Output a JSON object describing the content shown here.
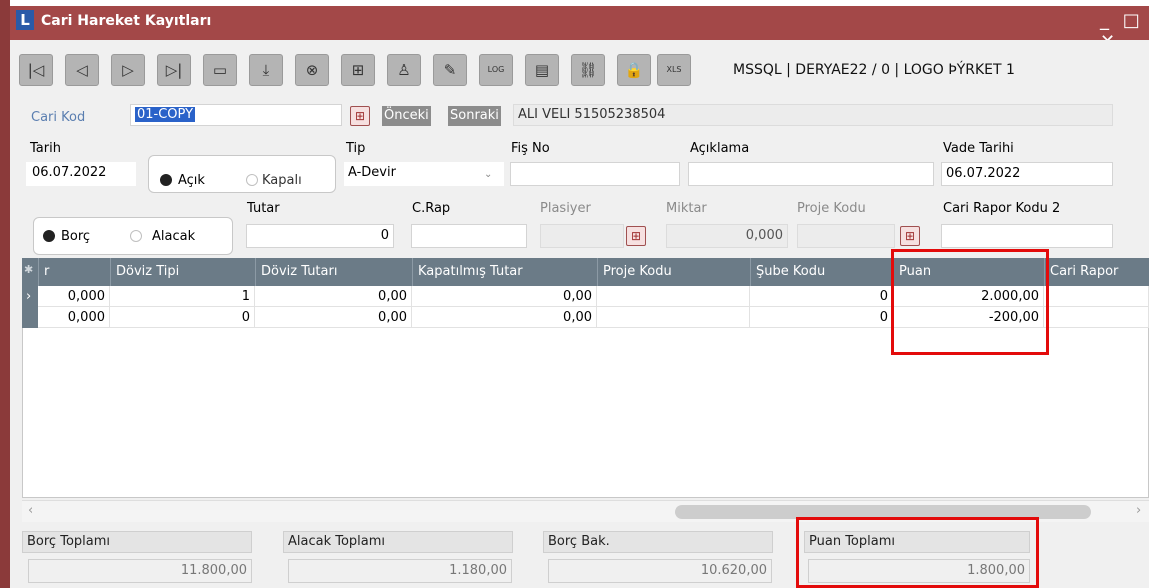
{
  "window": {
    "title": "Cari Hareket Kayıtları",
    "logo_letter": "L",
    "controls": "_ □ ✕"
  },
  "toolbar": {
    "db_info": "MSSQL | DERYAE22 / 0 | LOGO ÞÝRKET 1",
    "buttons": [
      {
        "name": "first-record",
        "glyph": "|◁"
      },
      {
        "name": "prev-record",
        "glyph": "◁"
      },
      {
        "name": "next-record",
        "glyph": "▷"
      },
      {
        "name": "last-record",
        "glyph": "▷|"
      },
      {
        "name": "browse",
        "glyph": "▭"
      },
      {
        "name": "download",
        "glyph": "⤓"
      },
      {
        "name": "cancel",
        "glyph": "⊗"
      },
      {
        "name": "new",
        "glyph": "⊞"
      },
      {
        "name": "user",
        "glyph": "♙"
      },
      {
        "name": "edit",
        "glyph": "✎"
      },
      {
        "name": "log",
        "glyph": "LOG"
      },
      {
        "name": "document",
        "glyph": "▤"
      },
      {
        "name": "link",
        "glyph": "⛓"
      },
      {
        "name": "lock",
        "glyph": "🔒"
      },
      {
        "name": "xls",
        "glyph": "XLS"
      }
    ]
  },
  "form": {
    "cari_kod_label": "Cari Kod",
    "cari_kod_value": "01-COPY",
    "onceki_label": "Önceki",
    "sonraki_label": "Sonraki",
    "cari_name": "ALI VELI 51505238504",
    "tarih_label": "Tarih",
    "tarih_value": "06.07.2022",
    "acik_label": "Açık",
    "kapali_label": "Kapalı",
    "tip_label": "Tip",
    "tip_value": "A-Devir",
    "fis_no_label": "Fiş No",
    "fis_no_value": "",
    "aciklama_label": "Açıklama",
    "aciklama_value": "",
    "vade_tarihi_label": "Vade Tarihi",
    "vade_tarihi_value": "06.07.2022",
    "tutar_label": "Tutar",
    "tutar_value": "0",
    "borc_label": "Borç",
    "alacak_label": "Alacak",
    "crap_label": "C.Rap",
    "plasiyer_label": "Plasiyer",
    "miktar_label": "Miktar",
    "miktar_value": "0,000",
    "proje_kodu_label": "Proje Kodu",
    "cari_rapor_kodu2_label": "Cari Rapor Kodu 2"
  },
  "grid": {
    "columns": [
      "r",
      "Döviz Tipi",
      "Döviz Tutarı",
      "Kapatılmış Tutar",
      "Proje Kodu",
      "Şube Kodu",
      "Puan",
      "Cari Rapor"
    ],
    "rows": [
      [
        "0,000",
        "1",
        "0,00",
        "0,00",
        "",
        "0",
        "2.000,00",
        ""
      ],
      [
        "0,000",
        "0",
        "0,00",
        "0,00",
        "",
        "0",
        "-200,00",
        ""
      ]
    ]
  },
  "footer": {
    "borc_toplami_label": "Borç Toplamı",
    "borc_toplami_value": "11.800,00",
    "alacak_toplami_label": "Alacak Toplamı",
    "alacak_toplami_value": "1.180,00",
    "borc_bak_label": "Borç Bak.",
    "borc_bak_value": "10.620,00",
    "puan_toplami_label": "Puan Toplamı",
    "puan_toplami_value": "1.800,00"
  },
  "colors": {
    "title_bar": "#a34848",
    "grid_header": "#6b7b87",
    "highlight": "#e30b0b"
  }
}
